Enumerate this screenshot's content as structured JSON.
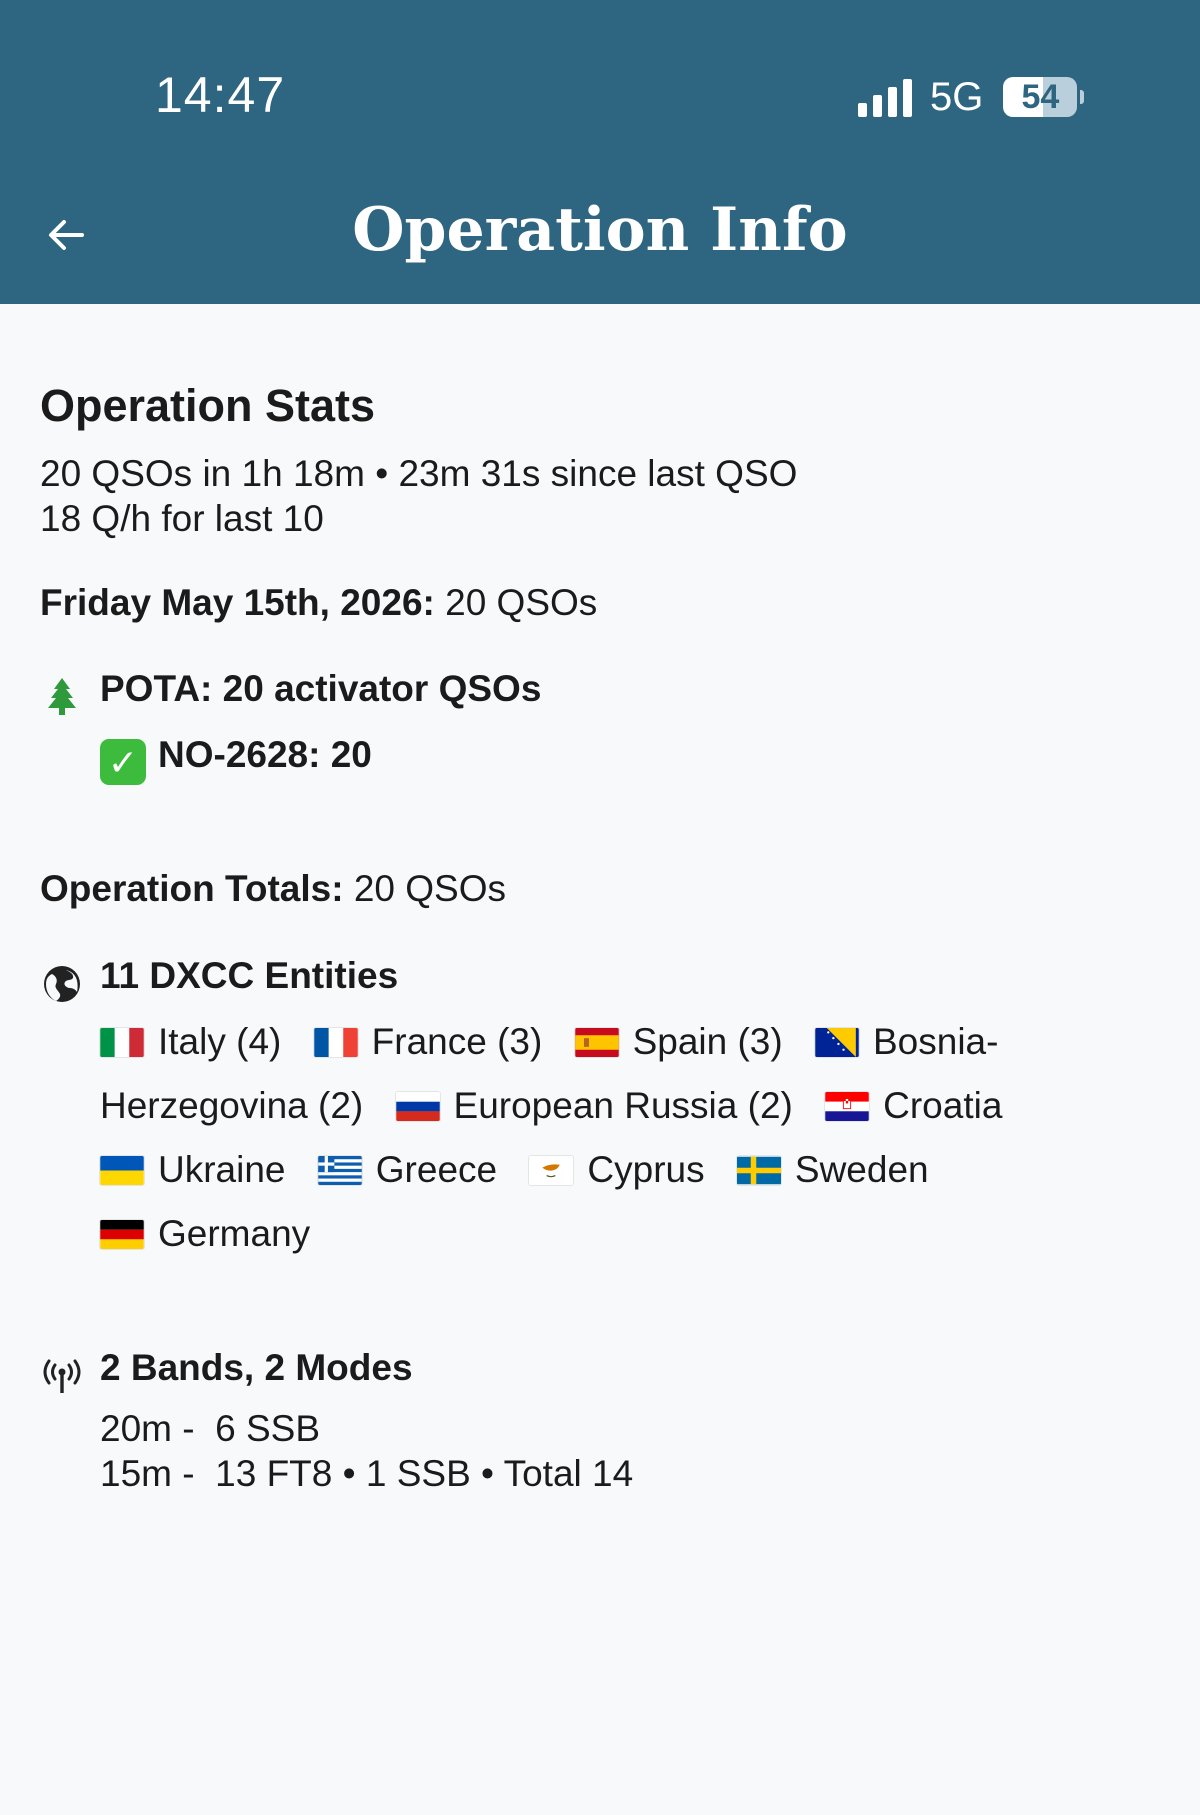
{
  "status_bar": {
    "time": "14:47",
    "network": "5G",
    "battery": "54",
    "icons": [
      "signal-bars-icon",
      "battery-icon"
    ]
  },
  "header": {
    "title": "Operation Info",
    "back_icon": "arrow-left-icon",
    "color": "#2e6581"
  },
  "stats": {
    "heading": "Operation Stats",
    "line1": "20 QSOs in 1h 18m • 23m 31s since last QSO",
    "line2": "18 Q/h for last 10"
  },
  "day": {
    "label": "Friday May 15th, 2026:",
    "value": " 20 QSOs"
  },
  "pota": {
    "icon": "tree-icon",
    "title": "POTA: 20 activator QSOs",
    "park_icon": "check-mark-icon",
    "park": "NO-2628: 20"
  },
  "totals": {
    "label": "Operation Totals:",
    "value": " 20 QSOs"
  },
  "dxcc": {
    "icon": "globe-icon",
    "title": "11 DXCC Entities",
    "entities": [
      {
        "flag": "italy-flag",
        "text": "Italy (4)"
      },
      {
        "flag": "france-flag",
        "text": "France (3)"
      },
      {
        "flag": "spain-flag",
        "text": "Spain (3)"
      },
      {
        "flag": "bosnia-flag",
        "text": "Bosnia-Herzegovina (2)"
      },
      {
        "flag": "russia-flag",
        "text": "European Russia (2)"
      },
      {
        "flag": "croatia-flag",
        "text": "Croatia"
      },
      {
        "flag": "ukraine-flag",
        "text": "Ukraine"
      },
      {
        "flag": "greece-flag",
        "text": "Greece"
      },
      {
        "flag": "cyprus-flag",
        "text": "Cyprus"
      },
      {
        "flag": "sweden-flag",
        "text": "Sweden"
      },
      {
        "flag": "germany-flag",
        "text": "Germany"
      }
    ]
  },
  "bands": {
    "icon": "antenna-icon",
    "title": "2 Bands, 2 Modes",
    "lines": [
      "20m -  6 SSB",
      "15m -  13 FT8 • 1 SSB • Total 14"
    ]
  }
}
